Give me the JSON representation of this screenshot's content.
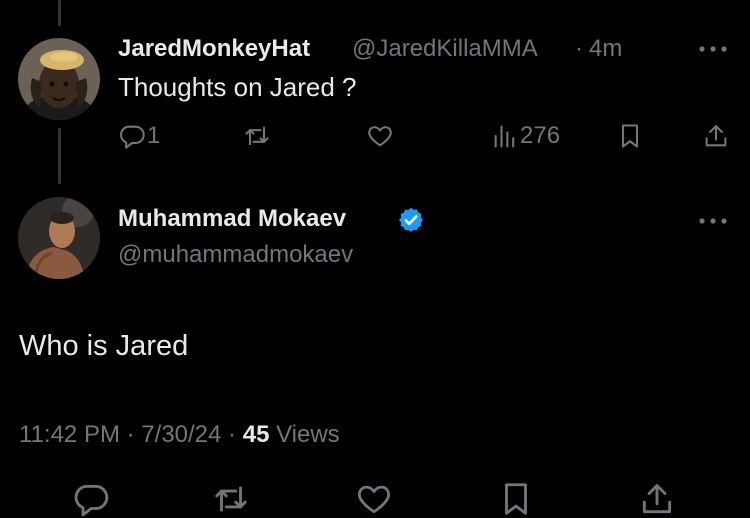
{
  "reply_tweet": {
    "display_name": "JaredMonkeyHat",
    "handle": "@JaredKillaMMA",
    "separator": "·",
    "time_ago": "4m",
    "text": "Thoughts on Jared ?",
    "reply_count": "1",
    "view_count": "276"
  },
  "main_tweet": {
    "display_name": "Muhammad Mokaev",
    "verified": true,
    "handle": "@muhammadmokaev",
    "text": "Who is Jared",
    "time": "11:42 PM",
    "date": "7/30/24",
    "views_count": "45",
    "views_label": "Views",
    "separator": "·"
  },
  "colors": {
    "background": "#000000",
    "text": "#e7e9ea",
    "muted": "#71767b",
    "verified": "#1d9bf0",
    "thread_line": "#333639"
  },
  "icons": [
    "reply-icon",
    "retweet-icon",
    "like-icon",
    "views-icon",
    "bookmark-icon",
    "share-icon",
    "more-icon",
    "verified-badge-icon"
  ]
}
